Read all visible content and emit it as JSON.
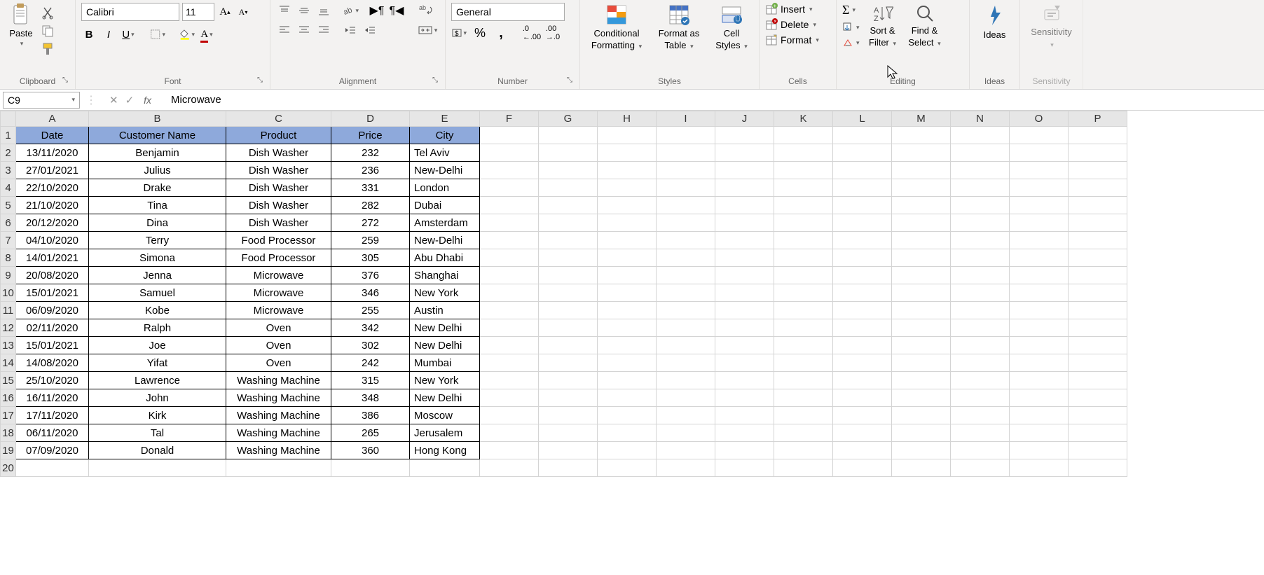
{
  "ribbon": {
    "clipboard": {
      "label": "Clipboard",
      "paste": "Paste"
    },
    "font": {
      "label": "Font",
      "name": "Calibri",
      "size": "11"
    },
    "alignment": {
      "label": "Alignment"
    },
    "number": {
      "label": "Number",
      "format": "General"
    },
    "styles": {
      "label": "Styles",
      "conditional": "Conditional Formatting",
      "formatAs": "Format as Table",
      "cellStyles": "Cell Styles"
    },
    "cells": {
      "label": "Cells",
      "insert": "Insert",
      "delete": "Delete",
      "format": "Format"
    },
    "editing": {
      "label": "Editing",
      "sortFilter": "Sort & Filter",
      "findSelect": "Find & Select"
    },
    "ideas": {
      "label": "Ideas",
      "btn": "Ideas"
    },
    "sensitivity": {
      "label": "Sensitivity",
      "btn": "Sensitivity"
    }
  },
  "formulaBar": {
    "nameBox": "C9",
    "formula": "Microwave"
  },
  "columns": [
    "A",
    "B",
    "C",
    "D",
    "E",
    "F",
    "G",
    "H",
    "I",
    "J",
    "K",
    "L",
    "M",
    "N",
    "O",
    "P"
  ],
  "headers": [
    "Date",
    "Customer Name",
    "Product",
    "Price",
    "City"
  ],
  "rows": [
    {
      "n": 1
    },
    {
      "n": 2,
      "d": [
        "13/11/2020",
        "Benjamin",
        "Dish Washer",
        "232",
        "Tel Aviv"
      ]
    },
    {
      "n": 3,
      "d": [
        "27/01/2021",
        "Julius",
        "Dish Washer",
        "236",
        "New-Delhi"
      ]
    },
    {
      "n": 4,
      "d": [
        "22/10/2020",
        "Drake",
        "Dish Washer",
        "331",
        "London"
      ]
    },
    {
      "n": 5,
      "d": [
        "21/10/2020",
        "Tina",
        "Dish Washer",
        "282",
        "Dubai"
      ]
    },
    {
      "n": 6,
      "d": [
        "20/12/2020",
        "Dina",
        "Dish Washer",
        "272",
        "Amsterdam"
      ]
    },
    {
      "n": 7,
      "d": [
        "04/10/2020",
        "Terry",
        "Food Processor",
        "259",
        "New-Delhi"
      ]
    },
    {
      "n": 8,
      "d": [
        "14/01/2021",
        "Simona",
        "Food Processor",
        "305",
        "Abu Dhabi"
      ]
    },
    {
      "n": 9,
      "d": [
        "20/08/2020",
        "Jenna",
        "Microwave",
        "376",
        "Shanghai"
      ]
    },
    {
      "n": 10,
      "d": [
        "15/01/2021",
        "Samuel",
        "Microwave",
        "346",
        "New York"
      ]
    },
    {
      "n": 11,
      "d": [
        "06/09/2020",
        "Kobe",
        "Microwave",
        "255",
        "Austin"
      ]
    },
    {
      "n": 12,
      "d": [
        "02/11/2020",
        "Ralph",
        "Oven",
        "342",
        "New Delhi"
      ]
    },
    {
      "n": 13,
      "d": [
        "15/01/2021",
        "Joe",
        "Oven",
        "302",
        "New Delhi"
      ]
    },
    {
      "n": 14,
      "d": [
        "14/08/2020",
        "Yifat",
        "Oven",
        "242",
        "Mumbai"
      ]
    },
    {
      "n": 15,
      "d": [
        "25/10/2020",
        "Lawrence",
        "Washing Machine",
        "315",
        "New York"
      ]
    },
    {
      "n": 16,
      "d": [
        "16/11/2020",
        "John",
        "Washing Machine",
        "348",
        "New Delhi"
      ]
    },
    {
      "n": 17,
      "d": [
        "17/11/2020",
        "Kirk",
        "Washing Machine",
        "386",
        "Moscow"
      ]
    },
    {
      "n": 18,
      "d": [
        "06/11/2020",
        "Tal",
        "Washing Machine",
        "265",
        "Jerusalem"
      ]
    },
    {
      "n": 19,
      "d": [
        "07/09/2020",
        "Donald",
        "Washing Machine",
        "360",
        "Hong Kong"
      ]
    },
    {
      "n": 20
    }
  ]
}
